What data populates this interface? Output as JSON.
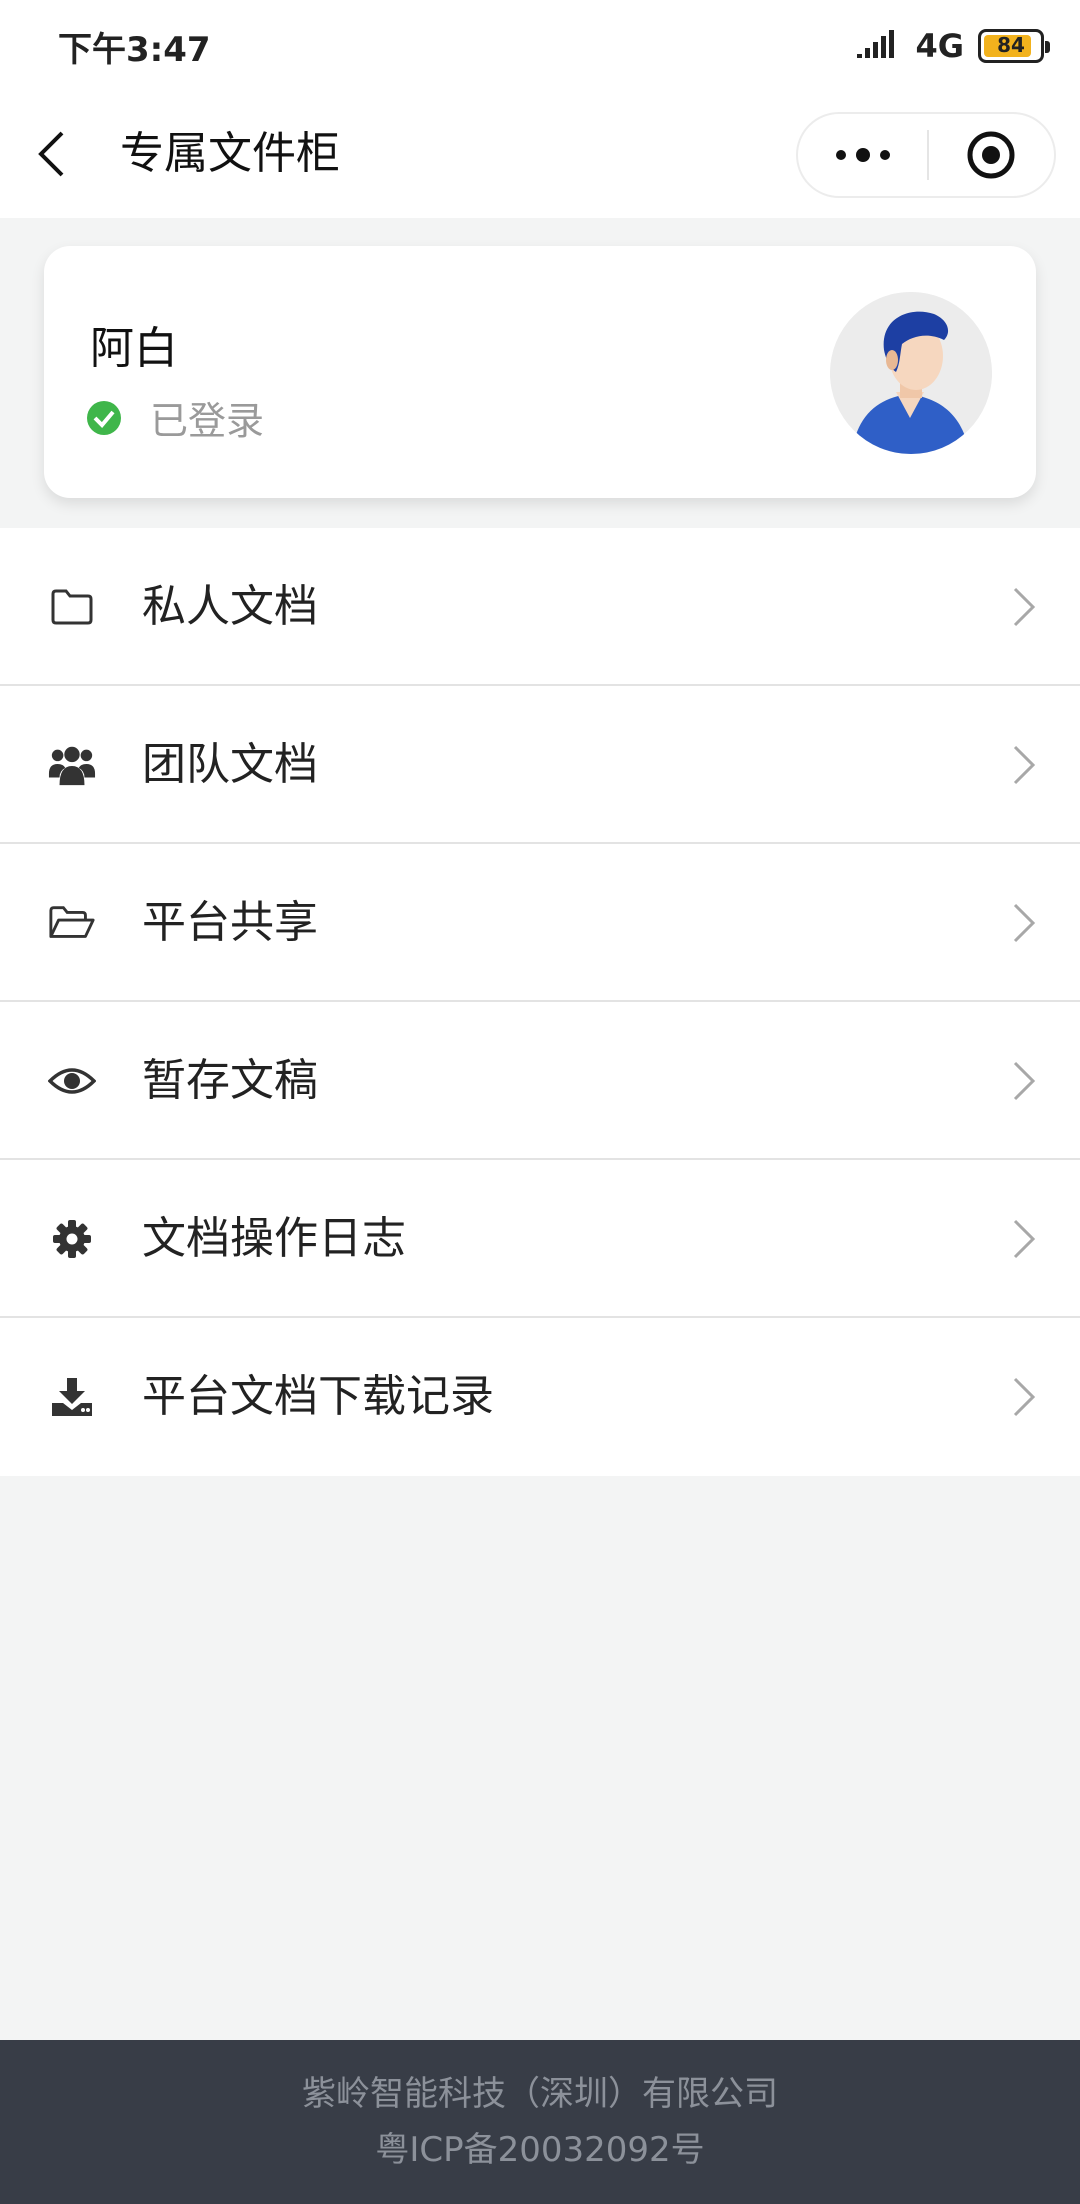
{
  "status_bar": {
    "time": "下午3:47",
    "network": "4G",
    "battery": "84"
  },
  "nav": {
    "title": "专属文件柜"
  },
  "profile": {
    "name": "阿白",
    "status": "已登录"
  },
  "menu": [
    {
      "label": "私人文档",
      "icon": "folder-icon"
    },
    {
      "label": "团队文档",
      "icon": "users-icon"
    },
    {
      "label": "平台共享",
      "icon": "folder-open-icon"
    },
    {
      "label": "暂存文稿",
      "icon": "eye-icon"
    },
    {
      "label": "文档操作日志",
      "icon": "gear-icon"
    },
    {
      "label": "平台文档下载记录",
      "icon": "download-icon"
    }
  ],
  "footer": {
    "company": "紫岭智能科技（深圳）有限公司",
    "icp": "粤ICP备20032092号"
  },
  "colors": {
    "accent_green": "#3fb64a",
    "footer_bg": "#383d47",
    "avatar_blue": "#2f5fc7"
  }
}
